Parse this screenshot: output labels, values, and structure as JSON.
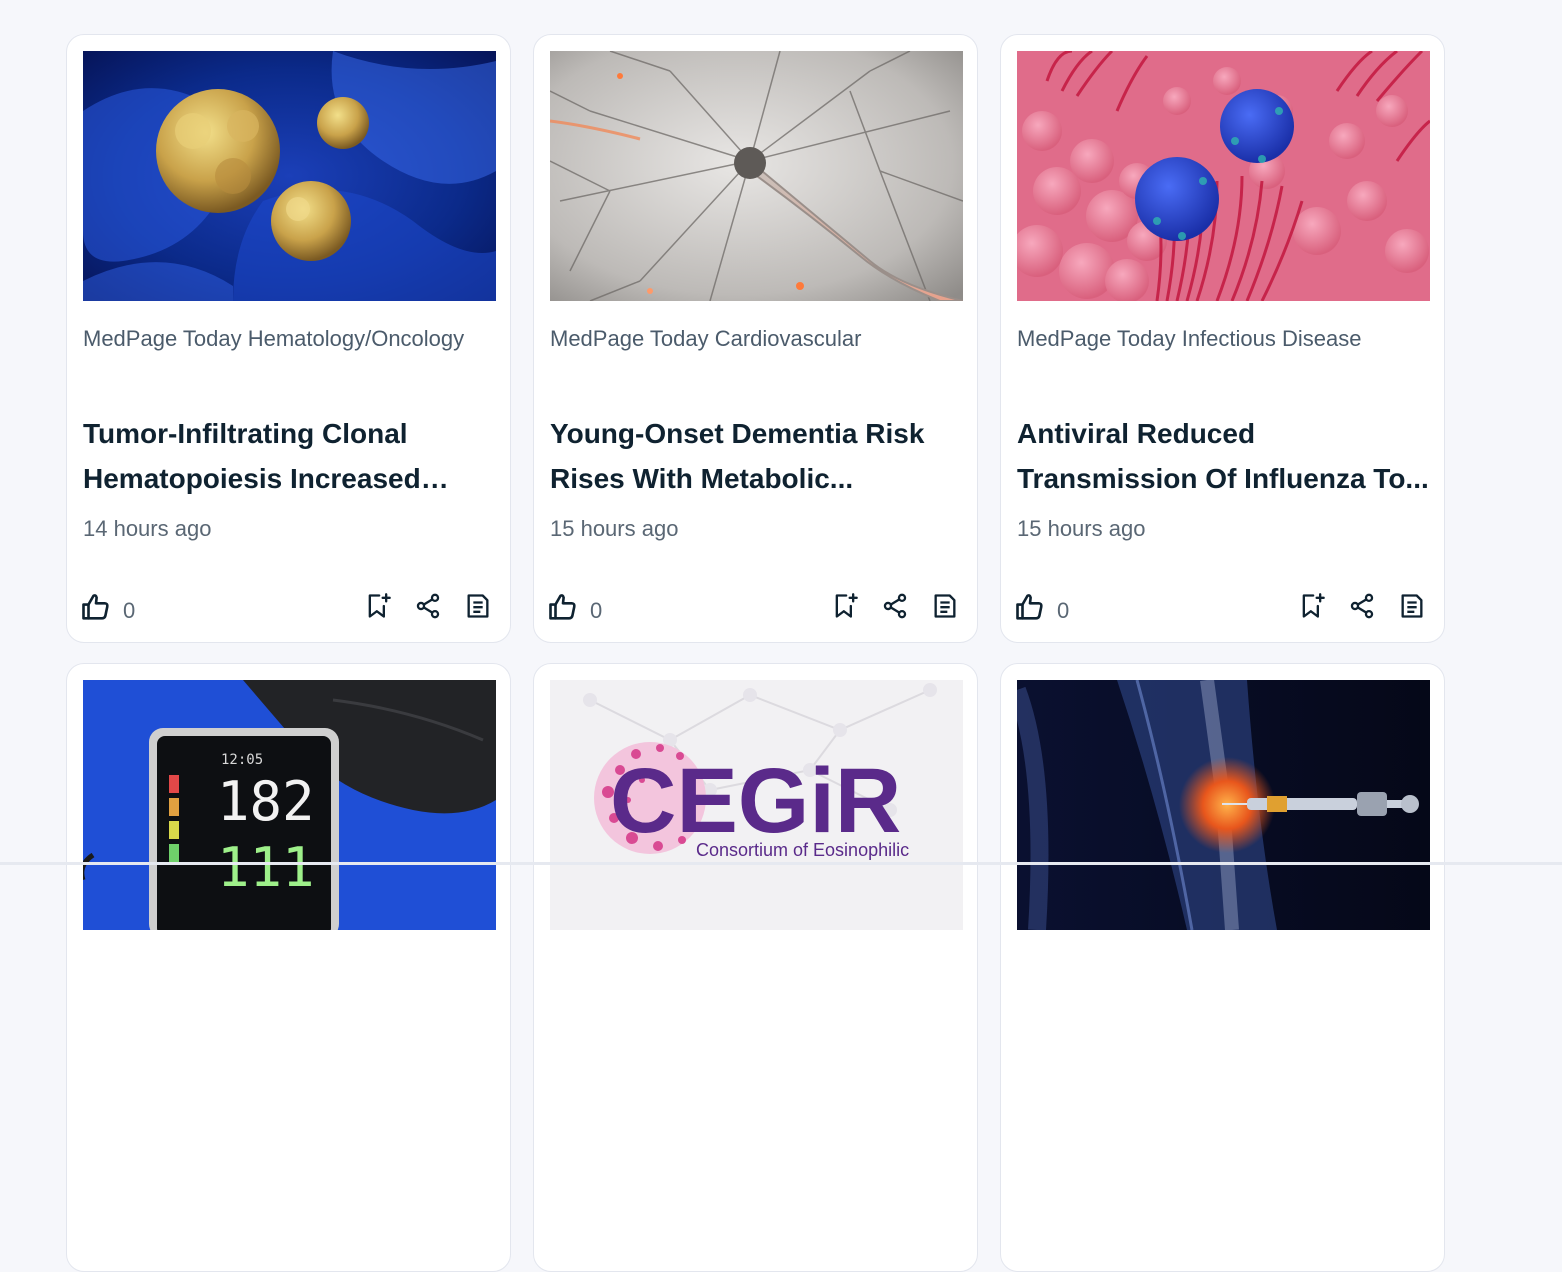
{
  "cards": [
    {
      "source": "MedPage Today Hematology/Oncology",
      "title": "Tumor-Infiltrating Clonal Hematopoiesis Increased Risk...",
      "time": "14 hours ago",
      "likes": "0",
      "image": "tumor-cells-image"
    },
    {
      "source": "MedPage Today Cardiovascular",
      "title": "Young-Onset Dementia Risk Rises With Metabolic...",
      "time": "15 hours ago",
      "likes": "0",
      "image": "neuron-image"
    },
    {
      "source": "MedPage Today Infectious Disease",
      "title": "Antiviral Reduced Transmission Of Influenza To...",
      "time": "15 hours ago",
      "likes": "0",
      "image": "virus-image"
    },
    {
      "image": "blood-pressure-monitor-image",
      "monitor_time": "12:05",
      "monitor_value_top": "182",
      "monitor_value_bottom": "111"
    },
    {
      "image": "cegir-logo-image",
      "logo_text": "CEGiR",
      "logo_subtitle": "Consortium of Eosinophilic"
    },
    {
      "image": "knee-injection-image"
    }
  ],
  "icons": {
    "like": "thumbs-up-icon",
    "save": "bookmark-add-icon",
    "share": "share-icon",
    "article": "article-icon"
  }
}
